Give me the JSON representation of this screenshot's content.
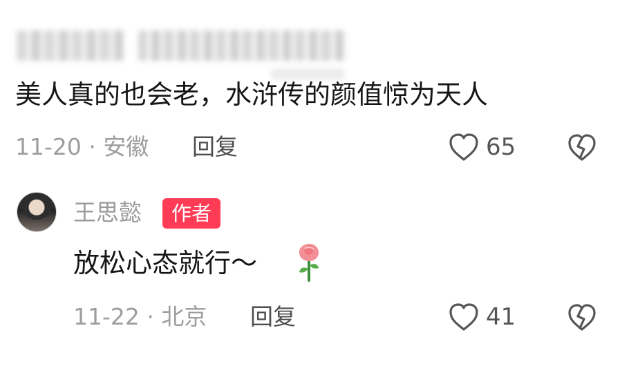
{
  "comments": [
    {
      "text": "美人真的也会老，水浒传的颜值惊为天人",
      "meta": "11-20 · 安徽",
      "reply_label": "回复",
      "likes": "65",
      "icons": {
        "like": "heart-outline",
        "dislike": "broken-heart-outline"
      }
    },
    {
      "author": "王思懿",
      "badge": "作者",
      "text": "放松心态就行～",
      "emoji": "rose-emoji",
      "meta": "11-22 · 北京",
      "reply_label": "回复",
      "likes": "41",
      "icons": {
        "like": "heart-outline",
        "dislike": "broken-heart-outline"
      }
    }
  ],
  "colors": {
    "text": "#161616",
    "meta": "#9d9d9d",
    "reply": "#4d4d4d",
    "badge": "#ff3b56"
  }
}
